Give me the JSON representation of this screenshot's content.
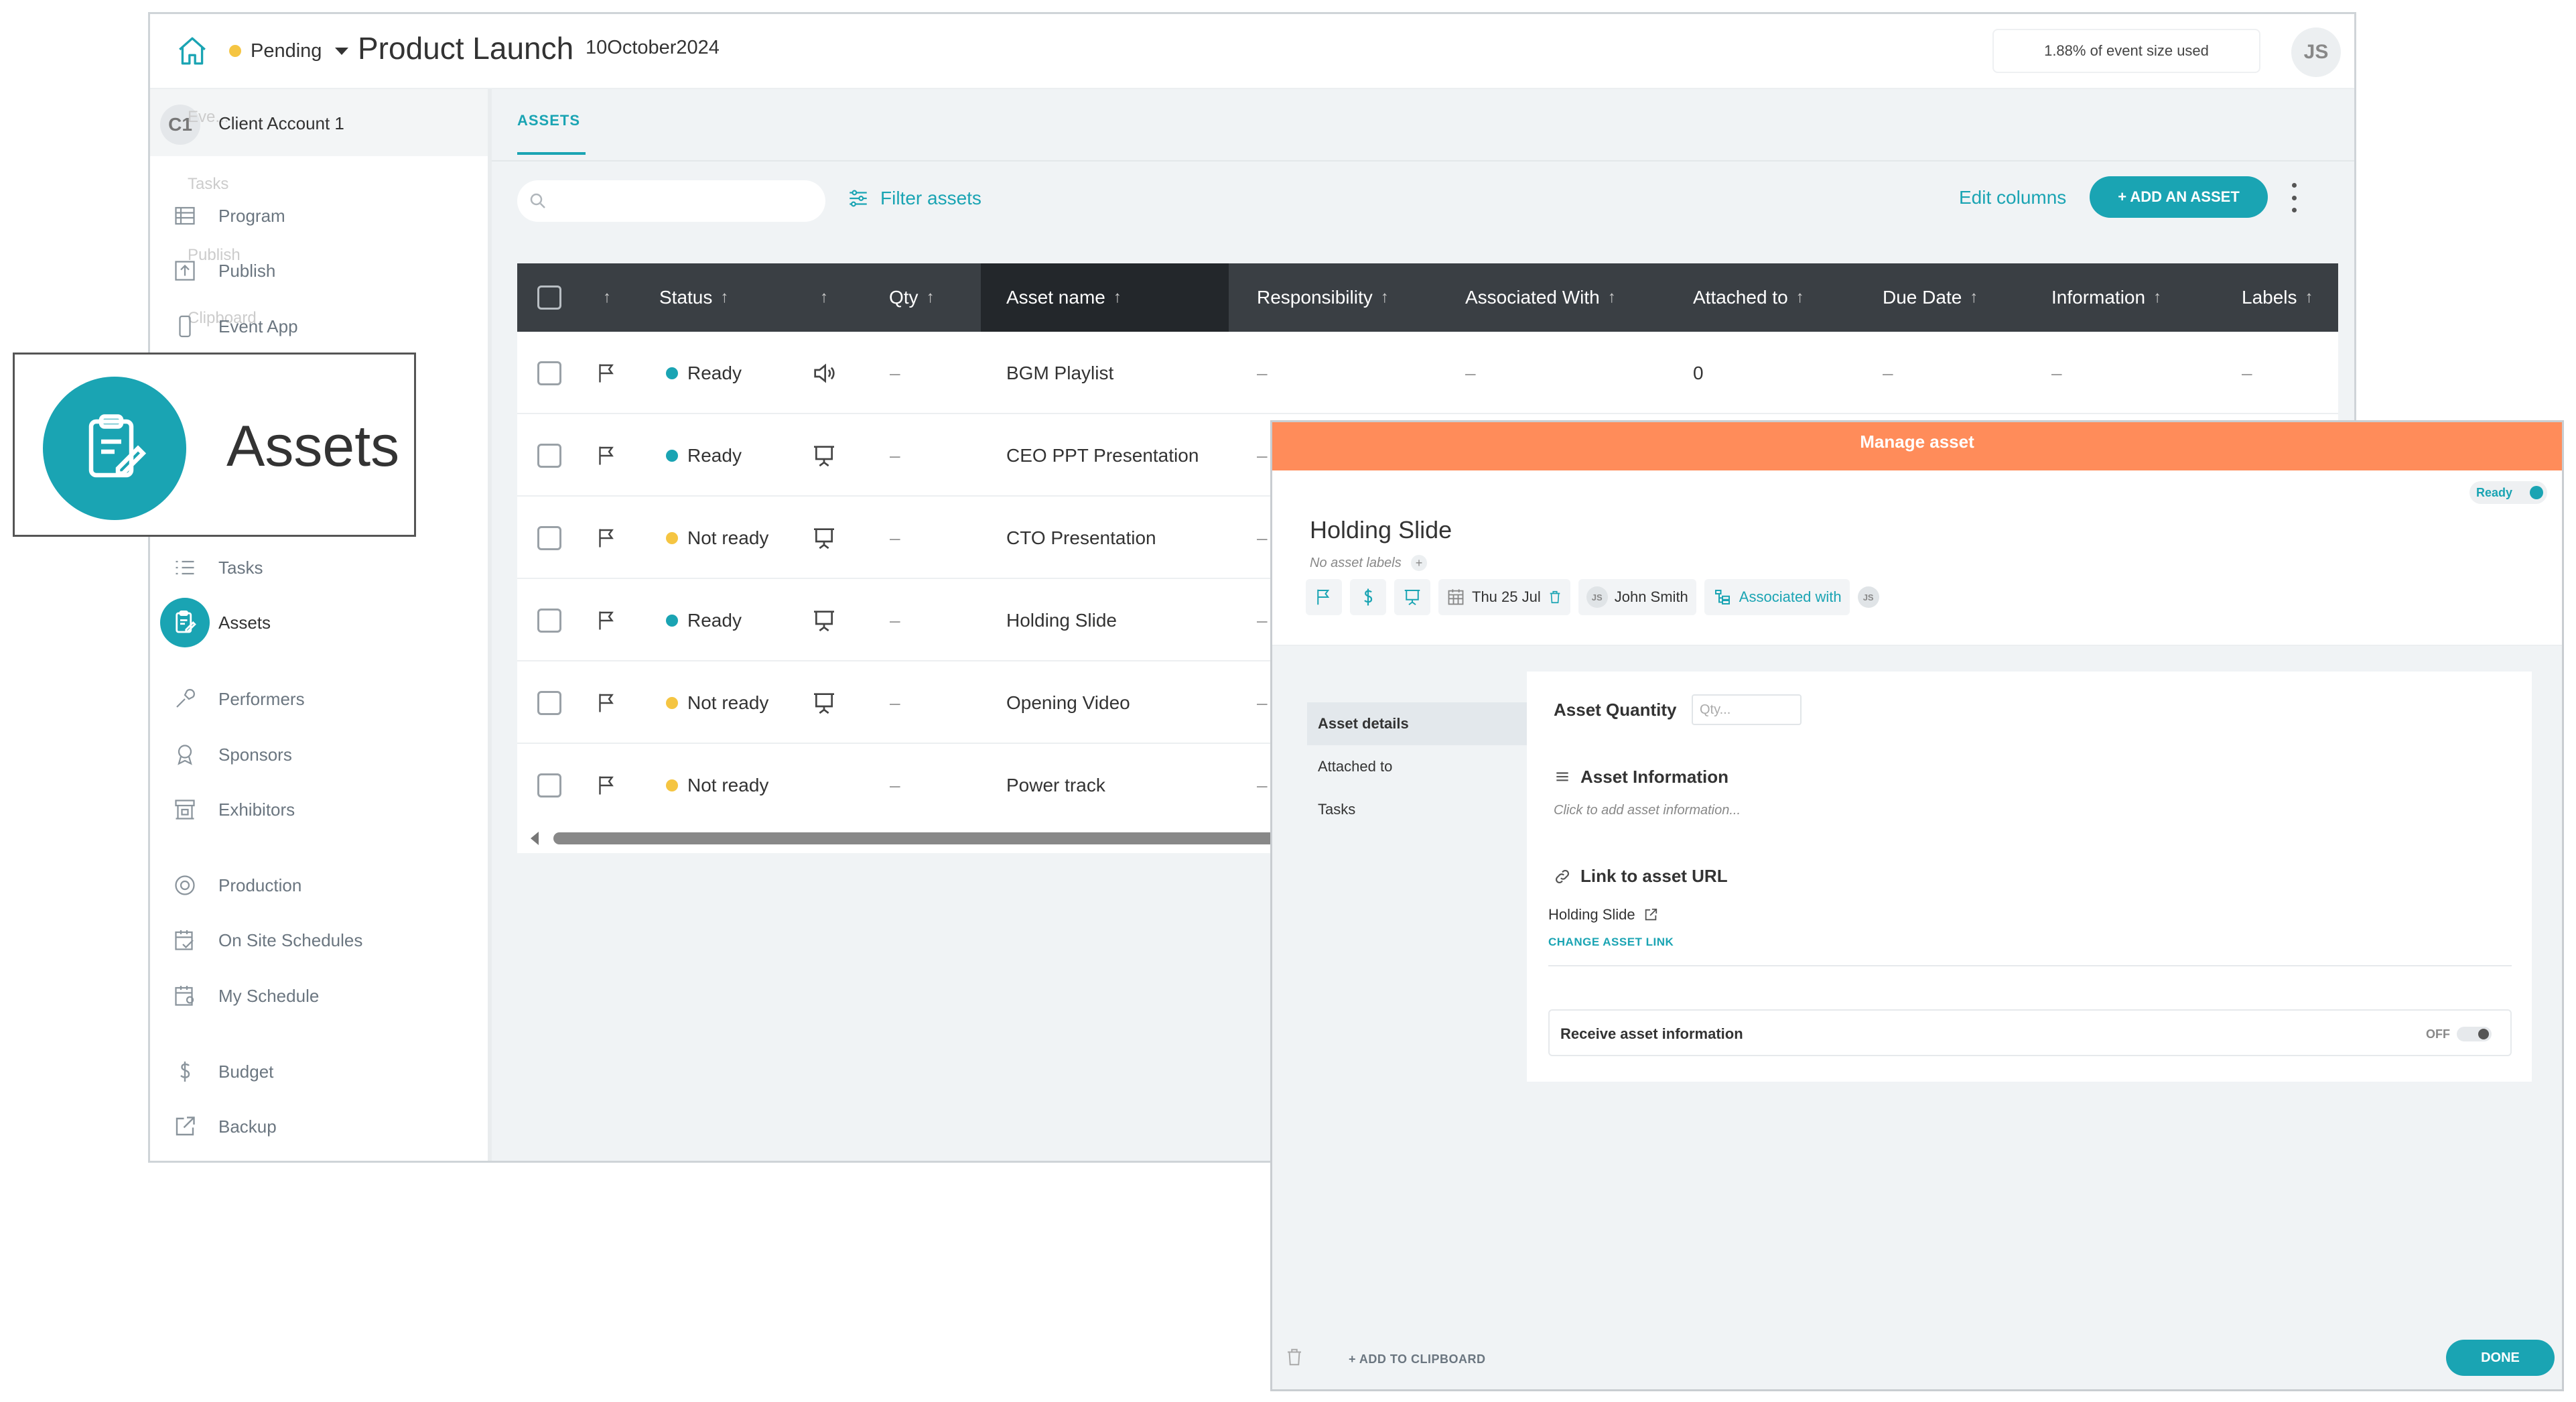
{
  "header": {
    "status": "Pending",
    "project_title": "Product Launch",
    "project_date": "10October2024",
    "usage": "1.88% of event size used",
    "user_initials": "JS"
  },
  "sidebar": {
    "client_initials": "C1",
    "client_name": "Client Account 1",
    "ghost_labels": [
      "Eve...",
      "Tasks",
      "Publish",
      "Clipboard"
    ],
    "items": [
      {
        "label": "Program"
      },
      {
        "label": "Publish"
      },
      {
        "label": "Event App"
      },
      {
        "label": "Tasks"
      },
      {
        "label": "Assets"
      },
      {
        "label": "Performers"
      },
      {
        "label": "Sponsors"
      },
      {
        "label": "Exhibitors"
      },
      {
        "label": "Production"
      },
      {
        "label": "On Site Schedules"
      },
      {
        "label": "My Schedule"
      },
      {
        "label": "Budget"
      },
      {
        "label": "Backup"
      }
    ]
  },
  "content": {
    "tab": "ASSETS",
    "filter_label": "Filter assets",
    "edit_columns": "Edit columns",
    "add_button": "+ ADD AN ASSET"
  },
  "table": {
    "columns": [
      "Status",
      "Qty",
      "Asset name",
      "Responsibility",
      "Associated With",
      "Attached to",
      "Due Date",
      "Information",
      "Labels"
    ],
    "rows": [
      {
        "status": "Ready",
        "status_color": "#1aa4b3",
        "type_icon": "speaker-icon",
        "qty": "–",
        "name": "BGM Playlist",
        "responsibility": "–",
        "associated": "–",
        "attached": "0",
        "due": "–",
        "info": "–",
        "labels": "–"
      },
      {
        "status": "Ready",
        "status_color": "#1aa4b3",
        "type_icon": "presentation-icon",
        "qty": "–",
        "name": "CEO PPT Presentation",
        "responsibility": "–"
      },
      {
        "status": "Not ready",
        "status_color": "#f5c542",
        "type_icon": "presentation-icon",
        "qty": "–",
        "name": "CTO Presentation",
        "responsibility": "–"
      },
      {
        "status": "Ready",
        "status_color": "#1aa4b3",
        "type_icon": "presentation-icon",
        "qty": "–",
        "name": "Holding Slide",
        "responsibility": "–"
      },
      {
        "status": "Not ready",
        "status_color": "#f5c542",
        "type_icon": "presentation-icon",
        "qty": "–",
        "name": "Opening Video",
        "responsibility": "–"
      },
      {
        "status": "Not ready",
        "status_color": "#f5c542",
        "type_icon": "",
        "qty": "–",
        "name": "Power track",
        "responsibility": "–"
      }
    ]
  },
  "callout": {
    "label": "Assets"
  },
  "modal": {
    "title": "Manage asset",
    "ready_label": "Ready",
    "asset_name": "Holding Slide",
    "no_labels": "No asset labels",
    "date_chip": "Thu 25 Jul",
    "person_initials": "JS",
    "person_name": "John Smith",
    "associated_chip": "Associated with",
    "assoc_initials": "JS",
    "tabs": [
      "Asset details",
      "Attached to",
      "Tasks"
    ],
    "qty_label": "Asset Quantity",
    "qty_placeholder": "Qty...",
    "info_title": "Asset Information",
    "info_hint": "Click to add asset information...",
    "link_title": "Link to asset URL",
    "link_name": "Holding Slide",
    "change_link": "CHANGE ASSET LINK",
    "receive_label": "Receive asset information",
    "receive_state": "OFF",
    "clipboard": "+ ADD TO CLIPBOARD",
    "done": "DONE"
  },
  "colors": {
    "accent": "#1aa4b3",
    "modal_header": "#ff8c5a",
    "pending": "#f5c542",
    "table_header": "#3a3f44"
  }
}
